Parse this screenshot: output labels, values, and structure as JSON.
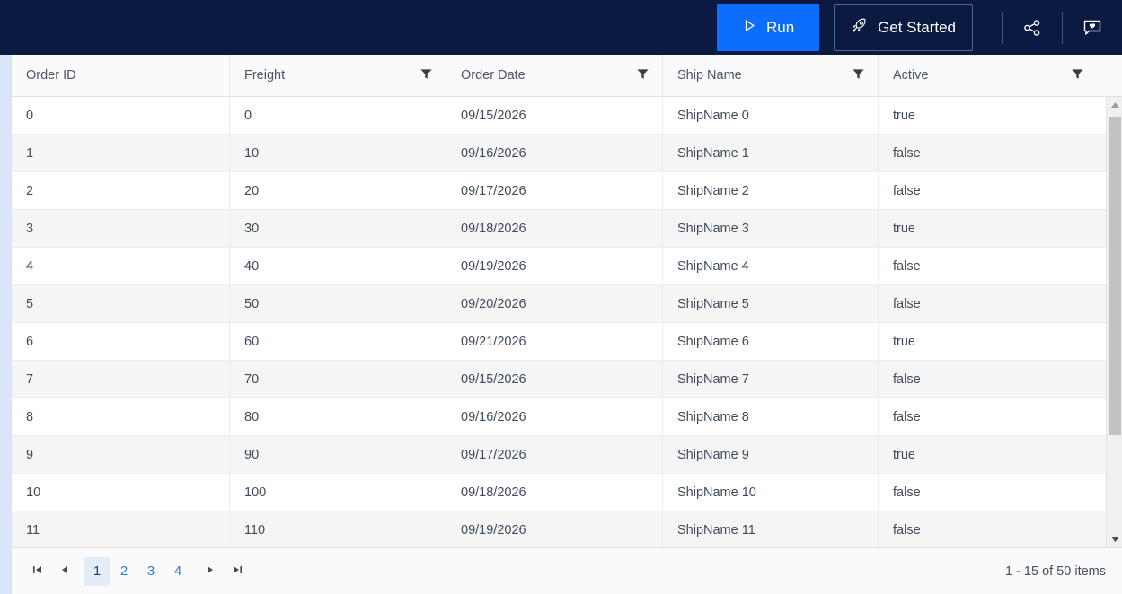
{
  "toolbar": {
    "run_label": "Run",
    "get_started_label": "Get Started",
    "run_icon": "play-triangle-icon",
    "get_started_icon": "rocket-icon",
    "share_icon": "share-nodes-icon",
    "feedback_icon": "speech-bubble-heart-icon",
    "accent_color": "#0d6efd",
    "background_color": "#0a1a40"
  },
  "grid": {
    "columns": [
      {
        "label": "Order ID",
        "filterable": false
      },
      {
        "label": "Freight",
        "filterable": true
      },
      {
        "label": "Order Date",
        "filterable": true
      },
      {
        "label": "Ship Name",
        "filterable": true
      },
      {
        "label": "Active",
        "filterable": true
      }
    ],
    "rows": [
      {
        "order_id": "0",
        "freight": "0",
        "order_date": "09/15/2026",
        "ship_name": "ShipName 0",
        "active": "true"
      },
      {
        "order_id": "1",
        "freight": "10",
        "order_date": "09/16/2026",
        "ship_name": "ShipName 1",
        "active": "false"
      },
      {
        "order_id": "2",
        "freight": "20",
        "order_date": "09/17/2026",
        "ship_name": "ShipName 2",
        "active": "false"
      },
      {
        "order_id": "3",
        "freight": "30",
        "order_date": "09/18/2026",
        "ship_name": "ShipName 3",
        "active": "true"
      },
      {
        "order_id": "4",
        "freight": "40",
        "order_date": "09/19/2026",
        "ship_name": "ShipName 4",
        "active": "false"
      },
      {
        "order_id": "5",
        "freight": "50",
        "order_date": "09/20/2026",
        "ship_name": "ShipName 5",
        "active": "false"
      },
      {
        "order_id": "6",
        "freight": "60",
        "order_date": "09/21/2026",
        "ship_name": "ShipName 6",
        "active": "true"
      },
      {
        "order_id": "7",
        "freight": "70",
        "order_date": "09/15/2026",
        "ship_name": "ShipName 7",
        "active": "false"
      },
      {
        "order_id": "8",
        "freight": "80",
        "order_date": "09/16/2026",
        "ship_name": "ShipName 8",
        "active": "false"
      },
      {
        "order_id": "9",
        "freight": "90",
        "order_date": "09/17/2026",
        "ship_name": "ShipName 9",
        "active": "true"
      },
      {
        "order_id": "10",
        "freight": "100",
        "order_date": "09/18/2026",
        "ship_name": "ShipName 10",
        "active": "false"
      },
      {
        "order_id": "11",
        "freight": "110",
        "order_date": "09/19/2026",
        "ship_name": "ShipName 11",
        "active": "false"
      }
    ]
  },
  "scrollbar": {
    "up_icon": "caret-up-icon",
    "down_icon": "caret-down-icon"
  },
  "pager": {
    "first_icon": "go-to-first-page-icon",
    "prev_icon": "previous-page-icon",
    "next_icon": "next-page-icon",
    "last_icon": "go-to-last-page-icon",
    "pages": [
      "1",
      "2",
      "3",
      "4"
    ],
    "current_page": "1",
    "info": "1 - 15 of 50 items"
  }
}
